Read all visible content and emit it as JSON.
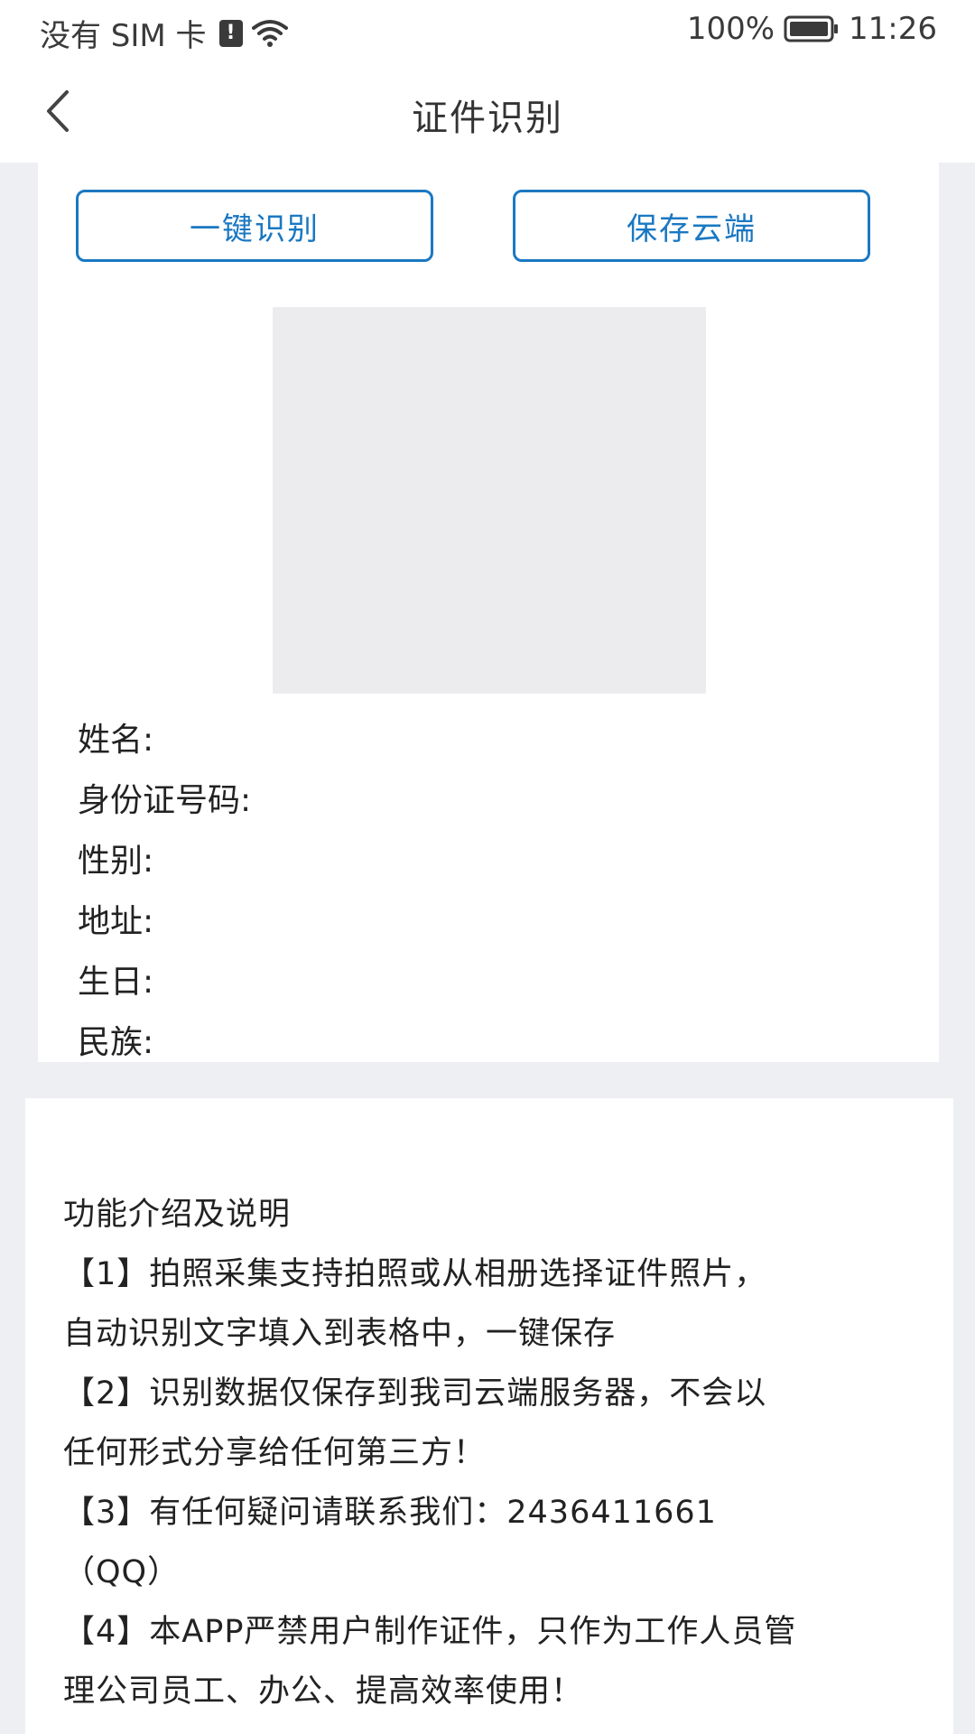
{
  "status_bar": {
    "carrier": "没有 SIM 卡",
    "alert_glyph": "!",
    "battery_text": "100%",
    "time": "11:26"
  },
  "nav": {
    "title": "证件识别"
  },
  "actions": {
    "recognize_label": "一键识别",
    "save_label": "保存云端"
  },
  "fields": {
    "name": "姓名:",
    "id_number": "身份证号码:",
    "gender": "性别:",
    "address": "地址:",
    "birthday": "生日:",
    "ethnicity": "民族:"
  },
  "info": {
    "title": "功能介绍及说明",
    "line1": "【1】拍照采集支持拍照或从相册选择证件照片，",
    "line2": "自动识别文字填入到表格中，一键保存",
    "line3": "【2】识别数据仅保存到我司云端服务器，不会以",
    "line4": "任何形式分享给任何第三方！",
    "line5": "【3】有任何疑问请联系我们：2436411661",
    "line6": "（QQ）",
    "line7": "【4】本APP严禁用户制作证件，只作为工作人员管",
    "line8": "理公司员工、办公、提高效率使用！"
  },
  "icons": {
    "back": "chevron-left-icon",
    "wifi": "wifi-icon",
    "battery": "battery-icon",
    "alert": "sim-alert-icon"
  },
  "colors": {
    "accent": "#1a78c2",
    "background": "#eeeff3",
    "placeholder": "#ececee"
  }
}
